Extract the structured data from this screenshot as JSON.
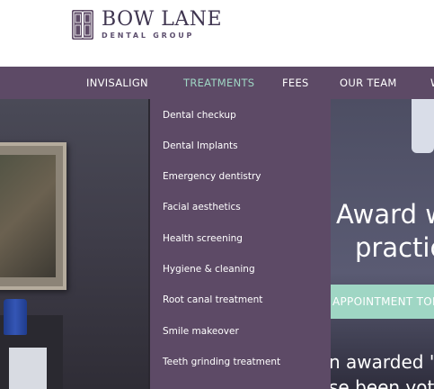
{
  "logo": {
    "name": "BOW LANE",
    "subtitle": "DENTAL GROUP"
  },
  "nav": {
    "items": [
      {
        "label": "INVISALIGN"
      },
      {
        "label": "TREATMENTS",
        "active": true
      },
      {
        "label": "FEES"
      },
      {
        "label": "OUR TEAM"
      },
      {
        "label": "W"
      }
    ]
  },
  "dropdown": {
    "items": [
      {
        "label": "Dental checkup"
      },
      {
        "label": "Dental Implants"
      },
      {
        "label": "Emergency dentistry"
      },
      {
        "label": "Facial aesthetics"
      },
      {
        "label": "Health screening"
      },
      {
        "label": "Hygiene & cleaning"
      },
      {
        "label": "Root canal treatment"
      },
      {
        "label": "Smile makeover"
      },
      {
        "label": "Teeth grinding treatment"
      }
    ]
  },
  "hero": {
    "title_line1": "Award w",
    "title_line2": "practic",
    "cta_label": "APPOINTMENT TODA",
    "text_line1": "n awarded 'B",
    "text_line2": "se been vote"
  },
  "colors": {
    "nav_bg": "#5d4a66",
    "accent": "#9fd6c4",
    "logo_text": "#3f3550"
  }
}
